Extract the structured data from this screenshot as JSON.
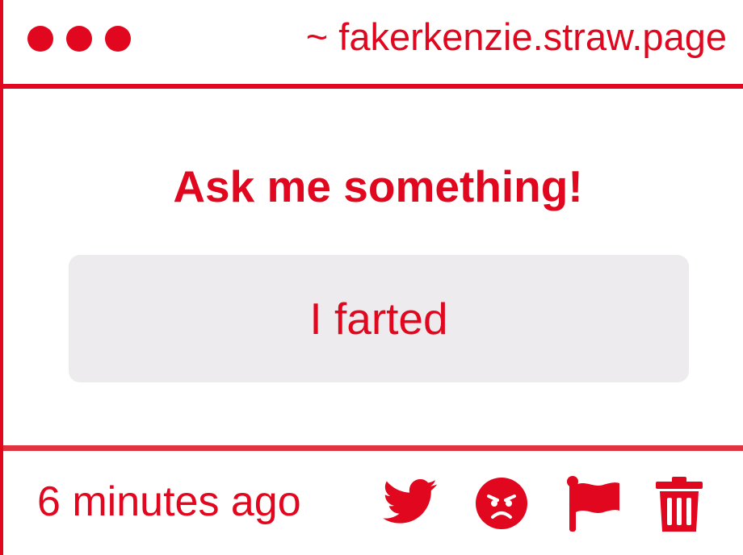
{
  "window": {
    "title": "~ fakerkenzie.straw.page",
    "control_dots": [
      "dot",
      "dot",
      "dot"
    ]
  },
  "main": {
    "heading": "Ask me something!",
    "message": "I farted"
  },
  "footer": {
    "timestamp": "6 minutes ago",
    "actions": [
      {
        "icon": "twitter-icon",
        "action": "share"
      },
      {
        "icon": "angry-face-icon",
        "action": "react"
      },
      {
        "icon": "flag-icon",
        "action": "report"
      },
      {
        "icon": "trash-icon",
        "action": "delete"
      }
    ]
  },
  "colors": {
    "accent": "#e0071e",
    "footer_rule": "#df3440",
    "message_background": "#edebed",
    "background": "#ffffff"
  }
}
